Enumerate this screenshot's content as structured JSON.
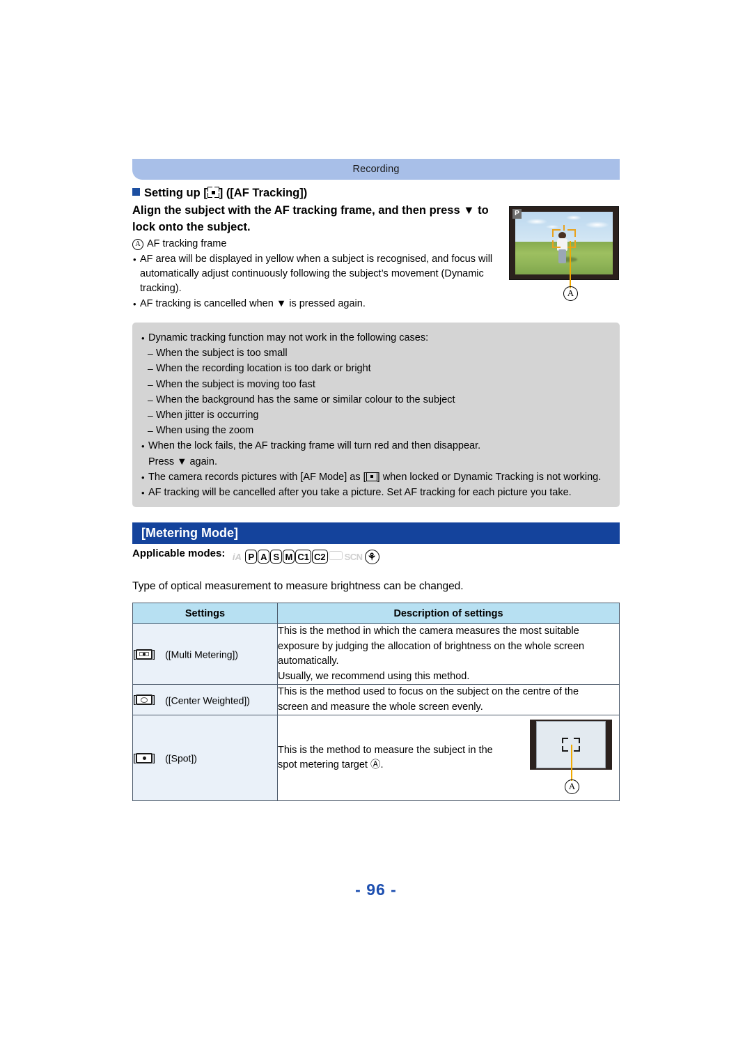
{
  "running_header": {
    "label": "Recording"
  },
  "af_section": {
    "heading": "Setting up [",
    "heading_icon": "af-tracking-icon",
    "heading_tail": "] ([AF Tracking])",
    "instruction": "Align the subject with the AF tracking frame, and then press ▼ to lock onto the subject.",
    "callout_label": "A",
    "callout_text": "AF tracking frame",
    "bullets": [
      "AF area will be displayed in yellow when a subject is recognised, and focus will automatically adjust continuously following the subject’s movement (Dynamic tracking).",
      "AF tracking is cancelled when ▼ is pressed again."
    ],
    "screen_illustration": {
      "mode_badge": "P",
      "callout_label": "A"
    }
  },
  "note_box": {
    "items": [
      {
        "type": "dot",
        "text": "Dynamic tracking function may not work in the following cases:"
      },
      {
        "type": "dash",
        "text": "When the subject is too small"
      },
      {
        "type": "dash",
        "text": "When the recording location is too dark or bright"
      },
      {
        "type": "dash",
        "text": "When the subject is moving too fast"
      },
      {
        "type": "dash",
        "text": "When the background has the same or similar colour to the subject"
      },
      {
        "type": "dash",
        "text": "When jitter is occurring"
      },
      {
        "type": "dash",
        "text": "When using the zoom"
      },
      {
        "type": "dot",
        "text": "When the lock fails, the AF tracking frame will turn red and then disappear."
      },
      {
        "type": "cont",
        "text": "Press ▼ again."
      },
      {
        "type": "dot_icon",
        "text_before": "The camera records pictures with [AF Mode] as [",
        "icon": "one-area-af-icon",
        "text_after": "] when locked or Dynamic Tracking is not working."
      },
      {
        "type": "dot",
        "text": "AF tracking will be cancelled after you take a picture. Set AF tracking for each picture you take."
      }
    ]
  },
  "metering_section": {
    "title": "[Metering Mode]",
    "applicable_label": "Applicable modes:",
    "modes": [
      {
        "name": "ia",
        "label": "iA",
        "active": false
      },
      {
        "name": "p",
        "label": "P",
        "active": true
      },
      {
        "name": "a",
        "label": "A",
        "active": true
      },
      {
        "name": "s",
        "label": "S",
        "active": true
      },
      {
        "name": "m",
        "label": "M",
        "active": true
      },
      {
        "name": "c1",
        "label": "C1",
        "active": true
      },
      {
        "name": "c2",
        "label": "C2",
        "active": true
      },
      {
        "name": "panorama",
        "label": "",
        "active": false
      },
      {
        "name": "scn",
        "label": "SCN",
        "active": false
      },
      {
        "name": "creative-control",
        "label": "⚘",
        "active": true
      }
    ],
    "intro": "Type of optical measurement to measure brightness can be changed.",
    "table": {
      "headers": [
        "Settings",
        "Description of settings"
      ],
      "rows": [
        {
          "icon": "multi-metering-icon",
          "setting": "([Multi Metering])",
          "description_lines": [
            "This is the method in which the camera measures the most suitable",
            "exposure by judging the allocation of brightness on the whole screen",
            "automatically.",
            "Usually, we recommend using this method."
          ]
        },
        {
          "icon": "center-weighted-icon",
          "setting": "([Center Weighted])",
          "description_lines": [
            "This is the method used to focus on the subject on the centre of the",
            "screen and measure the whole screen evenly."
          ]
        },
        {
          "icon": "spot-metering-icon",
          "setting": "([Spot])",
          "description_lines": [
            "This is the method to measure the subject in the",
            "spot metering target Ⓐ."
          ],
          "illustration_callout": "A"
        }
      ]
    }
  },
  "footer": {
    "page_number": "- 96 -"
  },
  "colors": {
    "running_header_bg": "#a8bfe8",
    "section_title_bg": "#14439c",
    "note_box_bg": "#d4d4d4",
    "table_header_bg": "#b7e0f2",
    "setting_cell_bg": "#eaf1f9",
    "page_number": "#1d4fb0",
    "af_frame_yellow": "#e8a21c"
  }
}
